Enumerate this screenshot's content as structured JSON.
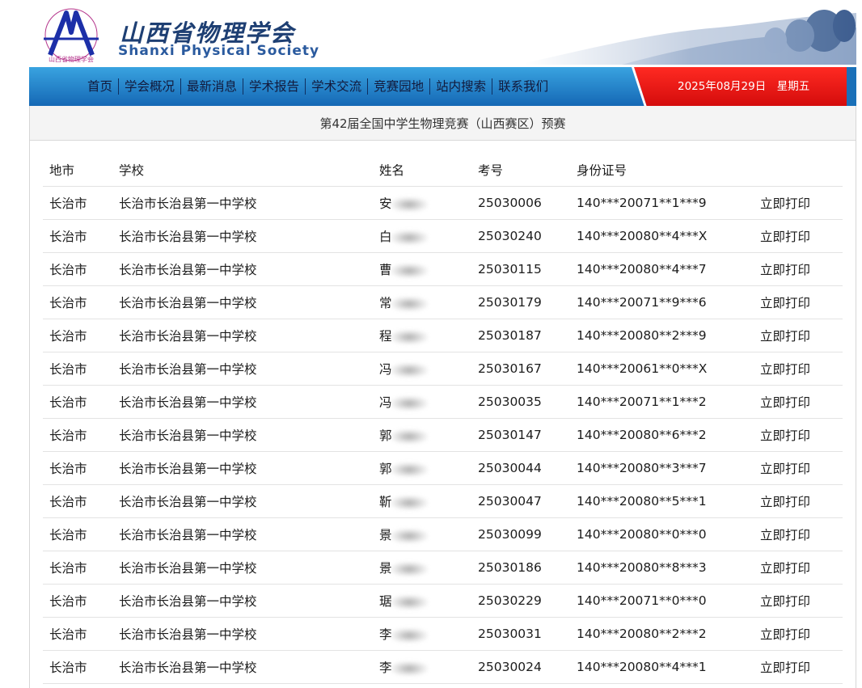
{
  "header": {
    "logo_text": "山西省物理学会",
    "title_cn": "山西省物理学会",
    "title_en": "Shanxi Physical Society"
  },
  "nav": {
    "items": [
      {
        "label": "首页"
      },
      {
        "label": "学会概况"
      },
      {
        "label": "最新消息"
      },
      {
        "label": "学术报告"
      },
      {
        "label": "学术交流"
      },
      {
        "label": "竞赛园地"
      },
      {
        "label": "站内搜索"
      },
      {
        "label": "联系我们"
      }
    ],
    "date_text": "2025年08月29日　星期五"
  },
  "page": {
    "title": "第42届全国中学生物理竞赛（山西赛区）预赛"
  },
  "table": {
    "headers": [
      "地市",
      "学校",
      "姓名",
      "考号",
      "身份证号",
      ""
    ],
    "action_label": "立即打印",
    "rows": [
      {
        "city": "长治市",
        "school": "长治市长治县第一中学校",
        "name_visible": "安",
        "exam_no": "25030006",
        "id_no": "140***20071**1***9"
      },
      {
        "city": "长治市",
        "school": "长治市长治县第一中学校",
        "name_visible": "白",
        "exam_no": "25030240",
        "id_no": "140***20080**4***X"
      },
      {
        "city": "长治市",
        "school": "长治市长治县第一中学校",
        "name_visible": "曹",
        "exam_no": "25030115",
        "id_no": "140***20080**4***7"
      },
      {
        "city": "长治市",
        "school": "长治市长治县第一中学校",
        "name_visible": "常",
        "exam_no": "25030179",
        "id_no": "140***20071**9***6"
      },
      {
        "city": "长治市",
        "school": "长治市长治县第一中学校",
        "name_visible": "程",
        "exam_no": "25030187",
        "id_no": "140***20080**2***9"
      },
      {
        "city": "长治市",
        "school": "长治市长治县第一中学校",
        "name_visible": "冯",
        "exam_no": "25030167",
        "id_no": "140***20061**0***X"
      },
      {
        "city": "长治市",
        "school": "长治市长治县第一中学校",
        "name_visible": "冯",
        "exam_no": "25030035",
        "id_no": "140***20071**1***2"
      },
      {
        "city": "长治市",
        "school": "长治市长治县第一中学校",
        "name_visible": "郭",
        "exam_no": "25030147",
        "id_no": "140***20080**6***2"
      },
      {
        "city": "长治市",
        "school": "长治市长治县第一中学校",
        "name_visible": "郭",
        "exam_no": "25030044",
        "id_no": "140***20080**3***7"
      },
      {
        "city": "长治市",
        "school": "长治市长治县第一中学校",
        "name_visible": "靳",
        "exam_no": "25030047",
        "id_no": "140***20080**5***1"
      },
      {
        "city": "长治市",
        "school": "长治市长治县第一中学校",
        "name_visible": "景",
        "exam_no": "25030099",
        "id_no": "140***20080**0***0"
      },
      {
        "city": "长治市",
        "school": "长治市长治县第一中学校",
        "name_visible": "景",
        "exam_no": "25030186",
        "id_no": "140***20080**8***3"
      },
      {
        "city": "长治市",
        "school": "长治市长治县第一中学校",
        "name_visible": "琚",
        "exam_no": "25030229",
        "id_no": "140***20071**0***0"
      },
      {
        "city": "长治市",
        "school": "长治市长治县第一中学校",
        "name_visible": "李",
        "exam_no": "25030031",
        "id_no": "140***20080**2***2"
      },
      {
        "city": "长治市",
        "school": "长治市长治县第一中学校",
        "name_visible": "李",
        "exam_no": "25030024",
        "id_no": "140***20080**4***1"
      }
    ]
  },
  "colors": {
    "nav_blue": "#1e7fd0",
    "date_red": "#e01616",
    "title_navy": "#1e3f73"
  }
}
